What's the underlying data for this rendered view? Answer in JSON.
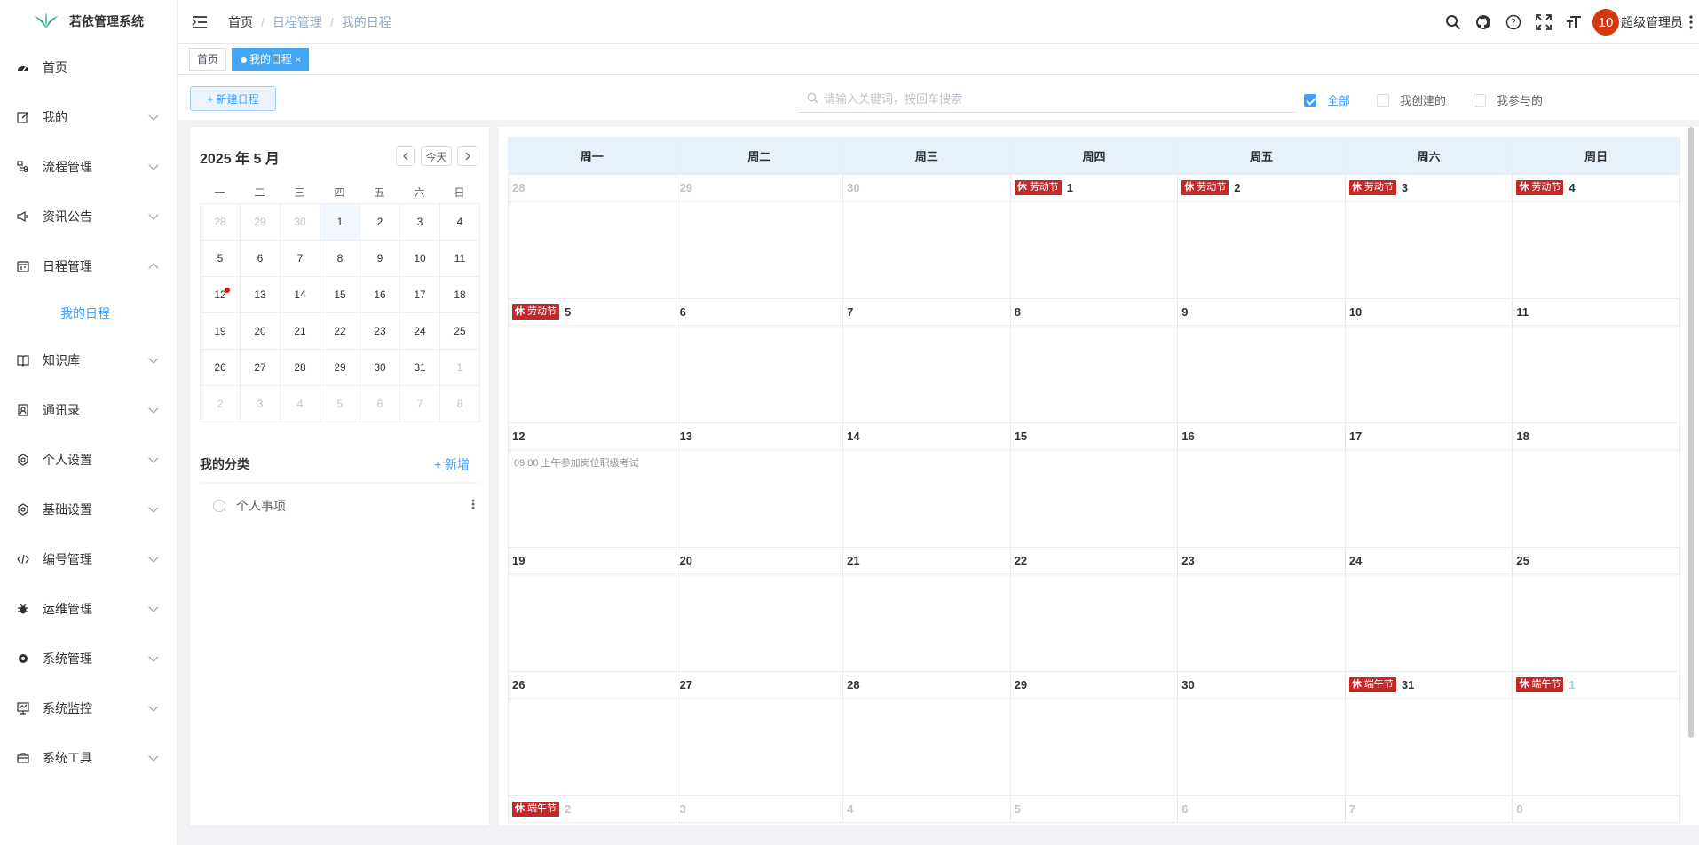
{
  "app": {
    "title": "若依管理系统"
  },
  "sidebar": {
    "items": [
      {
        "label": "首页",
        "icon": "dashboard-icon",
        "chevron": "none"
      },
      {
        "label": "我的",
        "icon": "edit-icon",
        "chevron": "down"
      },
      {
        "label": "流程管理",
        "icon": "flow-icon",
        "chevron": "down"
      },
      {
        "label": "资讯公告",
        "icon": "megaphone-icon",
        "chevron": "down"
      },
      {
        "label": "日程管理",
        "icon": "calendar-icon",
        "chevron": "up"
      },
      {
        "label": "知识库",
        "icon": "book-icon",
        "chevron": "down"
      },
      {
        "label": "通讯录",
        "icon": "contacts-icon",
        "chevron": "down"
      },
      {
        "label": "个人设置",
        "icon": "settings-icon",
        "chevron": "down"
      },
      {
        "label": "基础设置",
        "icon": "settings-icon",
        "chevron": "down"
      },
      {
        "label": "编号管理",
        "icon": "code-icon",
        "chevron": "down"
      },
      {
        "label": "运维管理",
        "icon": "bug-icon",
        "chevron": "down"
      },
      {
        "label": "系统管理",
        "icon": "gear-icon",
        "chevron": "down"
      },
      {
        "label": "系统监控",
        "icon": "monitor-icon",
        "chevron": "down"
      },
      {
        "label": "系统工具",
        "icon": "toolbox-icon",
        "chevron": "down"
      }
    ],
    "submenu": "我的日程"
  },
  "breadcrumb": [
    "首页",
    "日程管理",
    "我的日程"
  ],
  "user": {
    "avatar_text": "10",
    "name": "超级管理员"
  },
  "tags": [
    {
      "label": "首页"
    },
    {
      "label": "我的日程"
    }
  ],
  "toolbar": {
    "new_label": "+ 新建日程",
    "search_placeholder": "请输入关键词，按回车搜索",
    "filters": [
      "全部",
      "我创建的",
      "我参与的"
    ]
  },
  "mini": {
    "title": "2025 年 5 月",
    "today": "今天",
    "weekdays": [
      "一",
      "二",
      "三",
      "四",
      "五",
      "六",
      "日"
    ],
    "days": [
      [
        "28",
        1
      ],
      [
        "29",
        1
      ],
      [
        "30",
        1
      ],
      [
        "1",
        0,
        "t"
      ],
      [
        "2",
        0
      ],
      [
        "3",
        0
      ],
      [
        "4",
        0
      ],
      [
        "5",
        0
      ],
      [
        "6",
        0
      ],
      [
        "7",
        0
      ],
      [
        "8",
        0
      ],
      [
        "9",
        0
      ],
      [
        "10",
        0
      ],
      [
        "11",
        0
      ],
      [
        "12",
        0,
        "dot"
      ],
      [
        "13",
        0
      ],
      [
        "14",
        0
      ],
      [
        "15",
        0
      ],
      [
        "16",
        0
      ],
      [
        "17",
        0
      ],
      [
        "18",
        0
      ],
      [
        "19",
        0
      ],
      [
        "20",
        0
      ],
      [
        "21",
        0
      ],
      [
        "22",
        0
      ],
      [
        "23",
        0
      ],
      [
        "24",
        0
      ],
      [
        "25",
        0
      ],
      [
        "26",
        0
      ],
      [
        "27",
        0
      ],
      [
        "28",
        0
      ],
      [
        "29",
        0
      ],
      [
        "30",
        0
      ],
      [
        "31",
        0
      ],
      [
        "1",
        1
      ],
      [
        "2",
        1
      ],
      [
        "3",
        1
      ],
      [
        "4",
        1
      ],
      [
        "5",
        1
      ],
      [
        "6",
        1
      ],
      [
        "7",
        1
      ],
      [
        "8",
        1
      ]
    ]
  },
  "categories": {
    "title": "我的分类",
    "add": "+ 新增",
    "items": [
      "个人事项"
    ]
  },
  "calendar": {
    "weekdays": [
      "周一",
      "周二",
      "周三",
      "周四",
      "周五",
      "周六",
      "周日"
    ],
    "holiday_mark": "休",
    "cells": [
      {
        "d": "28",
        "o": 1
      },
      {
        "d": "29",
        "o": 1
      },
      {
        "d": "30",
        "o": 1
      },
      {
        "d": "1",
        "h": "劳动节"
      },
      {
        "d": "2",
        "h": "劳动节"
      },
      {
        "d": "3",
        "h": "劳动节"
      },
      {
        "d": "4",
        "h": "劳动节"
      },
      {
        "d": "5",
        "h": "劳动节"
      },
      {
        "d": "6"
      },
      {
        "d": "7"
      },
      {
        "d": "8"
      },
      {
        "d": "9"
      },
      {
        "d": "10"
      },
      {
        "d": "11"
      },
      {
        "d": "12",
        "ev": "09:00 上午参加岗位职级考试"
      },
      {
        "d": "13"
      },
      {
        "d": "14"
      },
      {
        "d": "15"
      },
      {
        "d": "16"
      },
      {
        "d": "17"
      },
      {
        "d": "18"
      },
      {
        "d": "19"
      },
      {
        "d": "20"
      },
      {
        "d": "21"
      },
      {
        "d": "22"
      },
      {
        "d": "23"
      },
      {
        "d": "24"
      },
      {
        "d": "25"
      },
      {
        "d": "26"
      },
      {
        "d": "27"
      },
      {
        "d": "28"
      },
      {
        "d": "29"
      },
      {
        "d": "30"
      },
      {
        "d": "31",
        "h": "端午节"
      },
      {
        "d": "1",
        "o": 1,
        "h": "端午节"
      },
      {
        "d": "2",
        "o": 1,
        "h": "端午节"
      },
      {
        "d": "3",
        "o": 1
      },
      {
        "d": "4",
        "o": 1
      },
      {
        "d": "5",
        "o": 1
      },
      {
        "d": "6",
        "o": 1
      },
      {
        "d": "7",
        "o": 1
      },
      {
        "d": "8",
        "o": 1
      }
    ]
  },
  "colors": {
    "accent": "#409eff",
    "holiday": "#c62828",
    "header_bg": "#e6f1fb"
  }
}
